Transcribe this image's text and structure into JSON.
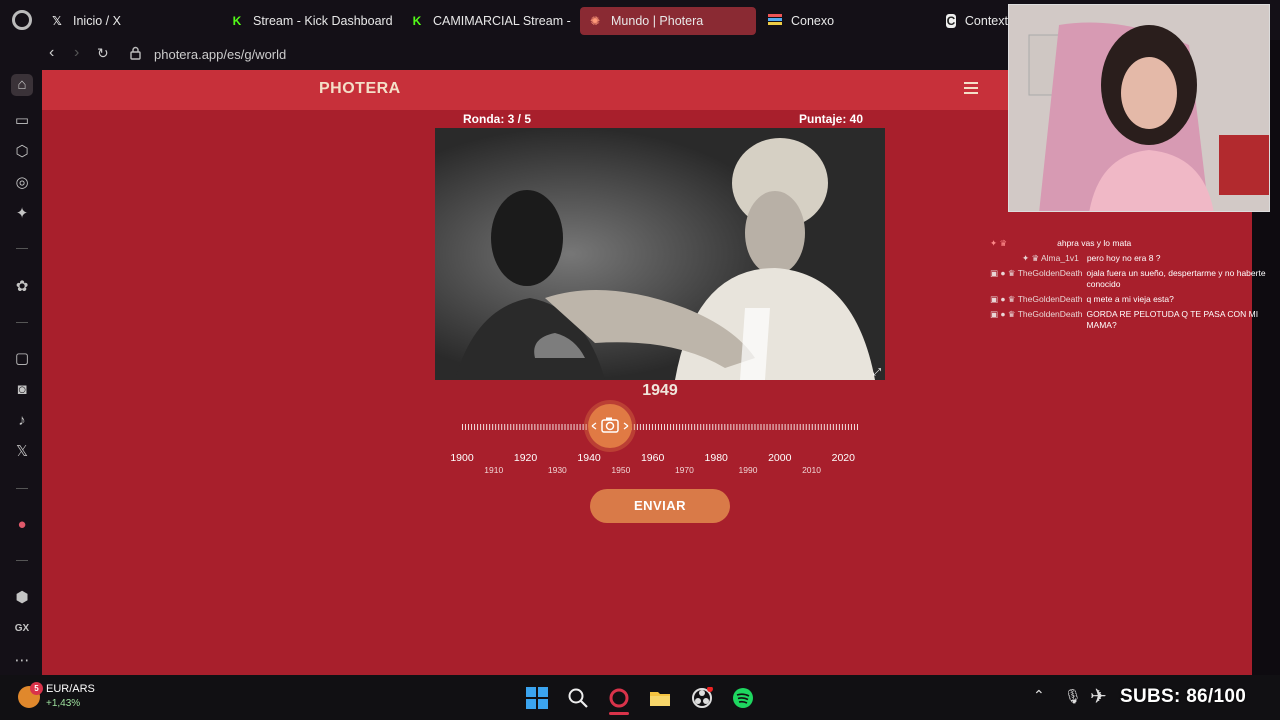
{
  "browser": {
    "tabs": [
      {
        "label": "Inicio / X",
        "icon": "x-logo-icon"
      },
      {
        "label": "Stream - Kick Dashboard",
        "icon": "kick-logo-icon"
      },
      {
        "label": "CAMIMARCIAL Stream - ",
        "icon": "kick-logo-icon"
      },
      {
        "label": "Mundo | Photera",
        "icon": "photera-favicon-icon",
        "active": true
      },
      {
        "label": "Conexo",
        "icon": "conexo-favicon-icon"
      },
      {
        "label": "Context",
        "icon": "context-favicon-icon"
      }
    ],
    "url": "photera.app/es/g/world"
  },
  "site": {
    "brand": "PHOTERA",
    "round_label": "Ronda: 3 / 5",
    "score_label": "Puntaje: 40",
    "selected_year": "1949",
    "slider": {
      "min": 1900,
      "max": 2025,
      "value": 1949,
      "major_ticks": [
        "1900",
        "1920",
        "1940",
        "1960",
        "1980",
        "2000",
        "2020"
      ],
      "minor_ticks": [
        "1910",
        "1930",
        "1950",
        "1970",
        "1990",
        "2010"
      ]
    },
    "send_label": "ENVIAR"
  },
  "chat": [
    {
      "user": "",
      "text": "ahpra vas y lo mata"
    },
    {
      "user": "Alma_1v1",
      "text": "pero hoy no era 8 ?"
    },
    {
      "user": "TheGoldenDeath",
      "text": "ojala fuera un sueño, despertarme y no haberte conocido"
    },
    {
      "user": "TheGoldenDeath",
      "text": "q mete a mi vieja esta?"
    },
    {
      "user": "TheGoldenDeath",
      "text": "GORDA RE PELOTUDA Q TE PASA CON MI MAMA?"
    }
  ],
  "taskbar": {
    "ticker_symbol": "EUR/ARS",
    "ticker_change": "+1,43%",
    "ticker_badge": "5",
    "subs_label": "SUBS: 86/100"
  },
  "colors": {
    "page_bg": "#a81f2c",
    "header_bg": "#c7303a",
    "accent": "#d97a48",
    "active_tab": "#8a2a33"
  }
}
